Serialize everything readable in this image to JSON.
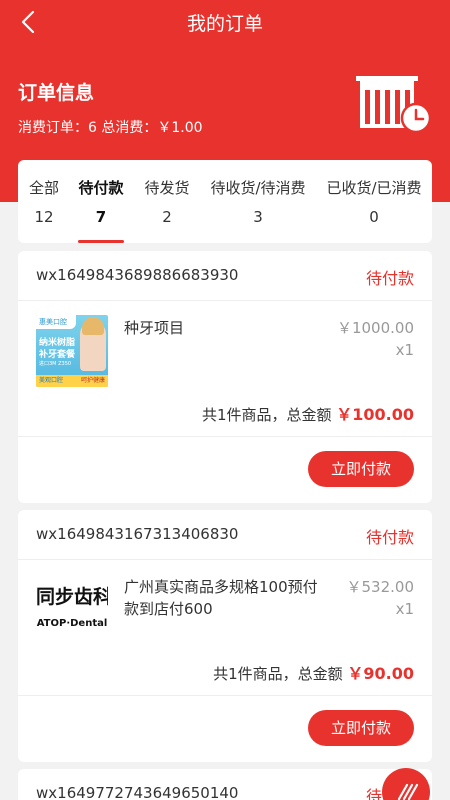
{
  "nav": {
    "title": "我的订单",
    "back_icon": "chevron-left-icon"
  },
  "info": {
    "title": "订单信息",
    "summary": "消费订单：6 总消费：￥1.00",
    "icon": "store-clock-icon"
  },
  "tabs": [
    {
      "label": "全部",
      "count": "12"
    },
    {
      "label": "待付款",
      "count": "7"
    },
    {
      "label": "待发货",
      "count": "2"
    },
    {
      "label": "待收货/待消费",
      "count": "3"
    },
    {
      "label": "已收货/已消费",
      "count": "0"
    }
  ],
  "active_tab": "待付款",
  "orders": [
    {
      "order_no": "wx1649843689886683930",
      "status": "待付款",
      "product_name": "种牙项目",
      "price": "￥1000.00",
      "qty": "x1",
      "total_prefix": "共1件商品，总金额 ",
      "total_amount": "￥100.00",
      "pay_label": "立即付款",
      "thumb": {
        "brand": "惠美口腔",
        "line1": "纳米树脂",
        "line2": "补牙套餐",
        "line3": "进口3M Z350",
        "tag1": "美观口腔",
        "tag2": "呵护健康"
      }
    },
    {
      "order_no": "wx1649843167313406830",
      "status": "待付款",
      "product_name": "广州真实商品多规格100预付款到店付600",
      "price": "￥532.00",
      "qty": "x1",
      "total_prefix": "共1件商品，总金额 ",
      "total_amount": "￥90.00",
      "pay_label": "立即付款",
      "thumb": {
        "cn": "同步齿科",
        "en": "ATOP·Dental"
      }
    },
    {
      "order_no": "wx1649772743649650140",
      "status": "待付款"
    }
  ],
  "colors": {
    "primary": "#e8322e",
    "background": "#f2f2f2"
  }
}
